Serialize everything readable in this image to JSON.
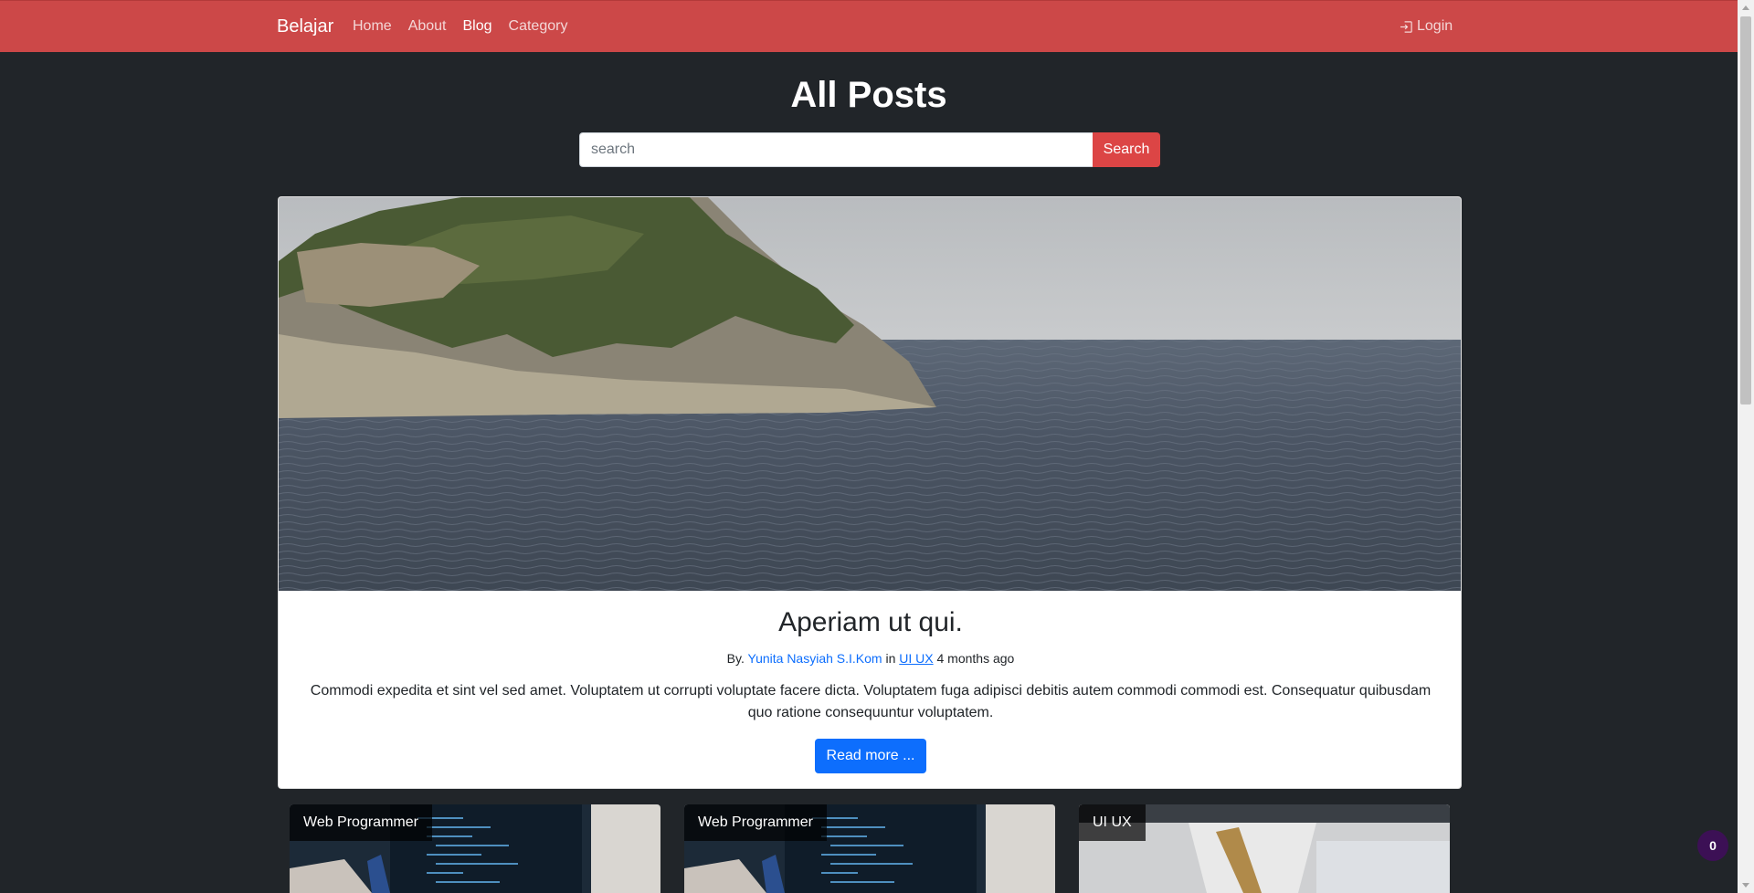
{
  "navbar": {
    "brand": "Belajar",
    "links": [
      {
        "label": "Home"
      },
      {
        "label": "About"
      },
      {
        "label": "Blog"
      },
      {
        "label": "Category"
      }
    ],
    "login_label": "Login"
  },
  "page_title": "All Posts",
  "search": {
    "placeholder": "search",
    "button_label": "Search"
  },
  "hero_post": {
    "title": "Aperiam ut qui.",
    "by_prefix": "By.",
    "author": "Yunita Nasyiah S.I.Kom",
    "in_word": "in",
    "category": "UI UX",
    "time_ago": "4 months ago",
    "excerpt": "Commodi expedita et sint vel sed amet. Voluptatem ut corrupti voluptate facere dicta. Voluptatem fuga adipisci debitis autem commodi commodi est. Consequatur quibusdam quo ratione consequuntur voluptatem.",
    "read_more": "Read more ..."
  },
  "posts": [
    {
      "category": "Web Programmer"
    },
    {
      "category": "Web Programmer"
    },
    {
      "category": "UI UX"
    }
  ],
  "counter_badge": "0",
  "colors": {
    "navbar": "#cc4848",
    "background": "#212529",
    "search_button": "#dc4545",
    "read_more_button": "#0d6efd",
    "link": "#0d6efd",
    "counter_badge": "#3c1055"
  },
  "icons": [
    "login-icon",
    "scroll-up-arrow-icon",
    "scroll-down-arrow-icon"
  ]
}
